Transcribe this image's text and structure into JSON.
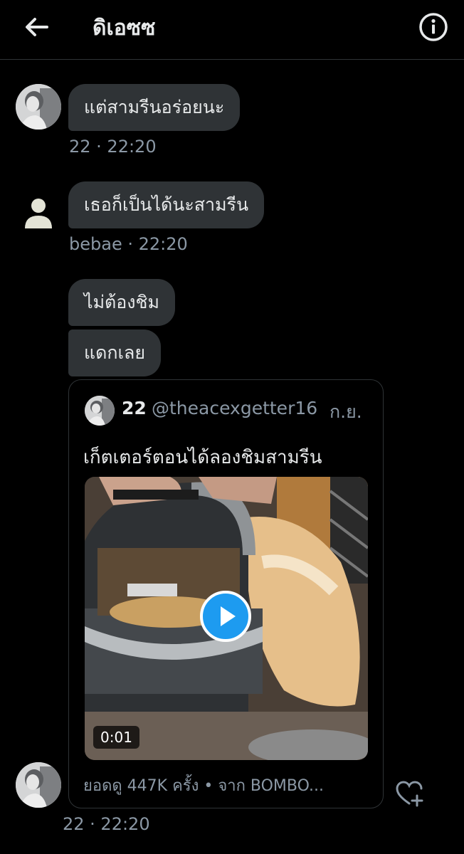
{
  "header": {
    "title": "ดิเอซซ"
  },
  "messages": [
    {
      "text": "แต่สามรีนอร่อยนะ",
      "meta": "22 · 22:20"
    },
    {
      "text": "เธอก็เป็นได้นะสามรีน",
      "meta": "bebae · 22:20"
    },
    {
      "text": "ไม่ต้องชิม"
    },
    {
      "text": "แดกเลย"
    }
  ],
  "quoted_tweet": {
    "name": "22",
    "handle": "@theacexgetter16",
    "date": "ก.ย.",
    "text": "เก็ตเตอร์ตอนได้ลองชิมสามรีน",
    "video_duration": "0:01",
    "views": "ยอดดู 447K ครั้ง • จาก BOMBO..."
  },
  "last_meta": "22 · 22:20",
  "colors": {
    "accent": "#1d9bf0",
    "bubble": "#2f3336",
    "muted": "#8b98a5"
  }
}
